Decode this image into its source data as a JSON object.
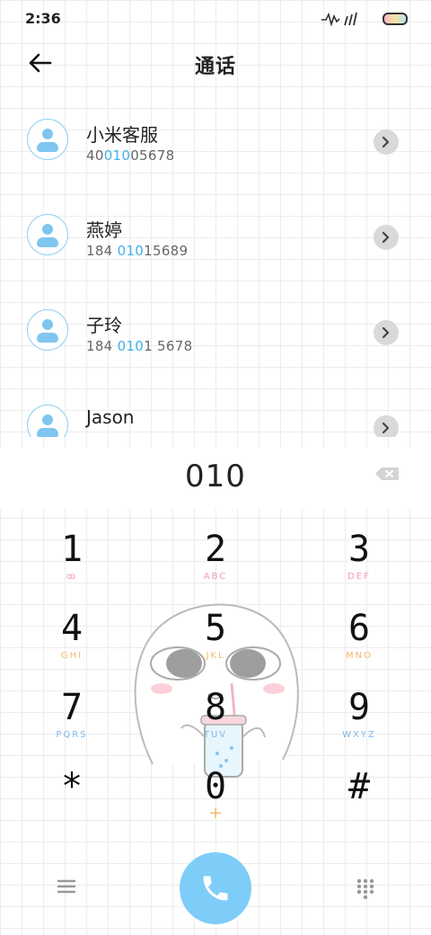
{
  "status": {
    "time": "2:36"
  },
  "header": {
    "title": "通话"
  },
  "contacts": [
    {
      "name": "小米客服",
      "num_pre": "40",
      "num_hl": "010",
      "num_post": "05678"
    },
    {
      "name": "燕婷",
      "num_pre": "184 ",
      "num_hl": "010",
      "num_post": "15689"
    },
    {
      "name": "子玲",
      "num_pre": "184 ",
      "num_hl": "010",
      "num_post": "1 5678"
    },
    {
      "name": "Jason",
      "num_pre": "",
      "num_hl": "",
      "num_post": ""
    }
  ],
  "dial": {
    "input": "010"
  },
  "keys": [
    {
      "num": "1",
      "sub": "ꝏ"
    },
    {
      "num": "2",
      "sub": "ABC"
    },
    {
      "num": "3",
      "sub": "DEF"
    },
    {
      "num": "4",
      "sub": "GHI"
    },
    {
      "num": "5",
      "sub": "JKL"
    },
    {
      "num": "6",
      "sub": "MNO"
    },
    {
      "num": "7",
      "sub": "PQRS"
    },
    {
      "num": "8",
      "sub": "TUV"
    },
    {
      "num": "9",
      "sub": "WXYZ"
    },
    {
      "num": "*",
      "sub": ""
    },
    {
      "num": "0",
      "sub": "+"
    },
    {
      "num": "#",
      "sub": ""
    }
  ],
  "colors": {
    "accent": "#7ecdf8",
    "highlight": "#3fb1e8",
    "sub_pink": "#f29ab2",
    "sub_orange": "#f5b76a",
    "sub_blue": "#7db8ea"
  },
  "icons": {
    "back": "arrow-left-icon",
    "chevron": "chevron-right-icon",
    "backspace": "backspace-icon",
    "menu": "menu-icon",
    "call": "phone-icon",
    "keypad": "dialpad-icon"
  }
}
